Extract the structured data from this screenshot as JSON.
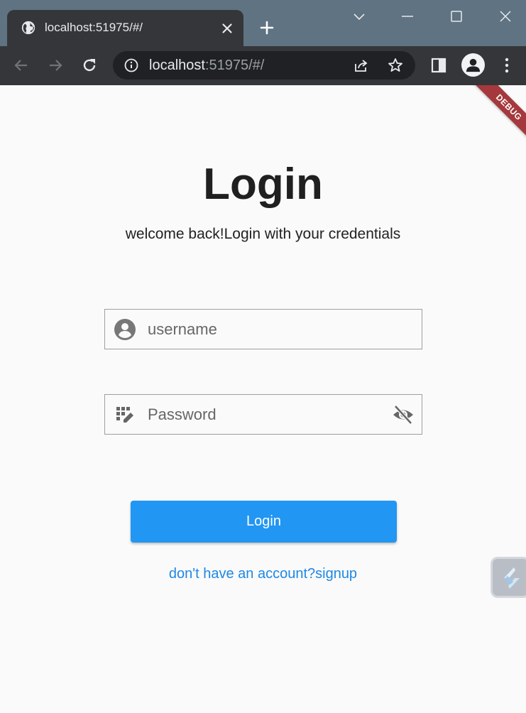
{
  "browser": {
    "tab_title": "localhost:51975/#/",
    "url_host": "localhost",
    "url_rest": ":51975/#/"
  },
  "page": {
    "debug_banner": "DEBUG",
    "title": "Login",
    "subtitle": "welcome back!Login with your credentials",
    "username_placeholder": "username",
    "password_placeholder": "Password",
    "login_button": "Login",
    "signup_link": "don't have an account?signup"
  },
  "colors": {
    "tabstrip": "#5f7382",
    "toolbar": "#35363a",
    "primary": "#2196f3",
    "link": "#1e88e5",
    "debug_banner": "#a5383c"
  },
  "icons": [
    "globe-icon",
    "close-icon",
    "plus-icon",
    "chevron-down-icon",
    "minimize-icon",
    "maximize-icon",
    "window-close-icon",
    "back-arrow-icon",
    "forward-arrow-icon",
    "reload-icon",
    "info-icon",
    "share-icon",
    "star-icon",
    "side-panel-icon",
    "profile-icon",
    "kebab-menu-icon",
    "account-circle-icon",
    "password-keypad-icon",
    "eye-off-icon",
    "floating-widget-icon"
  ]
}
